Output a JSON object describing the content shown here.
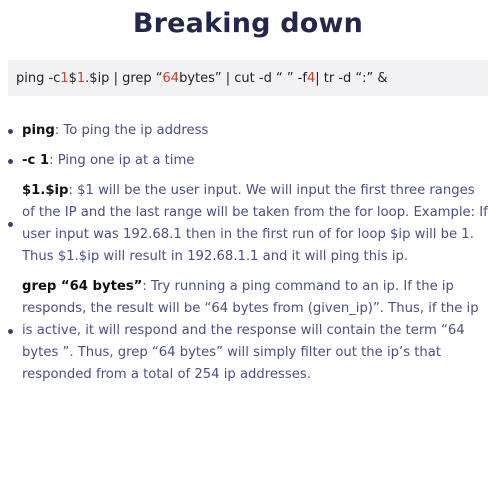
{
  "title": "Breaking down",
  "command": {
    "p1": "ping -c ",
    "n1": "1",
    "p2": " $",
    "n2": "1",
    "p3": ".$ip | grep “",
    "n3": "64",
    "p4": " bytes” | cut -d “ ” -f ",
    "n4": "4",
    "p5": " | tr -d “:” &"
  },
  "bullets": [
    {
      "term": "ping",
      "text": ": To ping the ip address"
    },
    {
      "term": "-c 1",
      "text": ": Ping one ip at a time"
    },
    {
      "term": "$1.$ip",
      "text": ": $1 will be the user input. We will input the first three ranges of the IP and the last range will be taken from the for loop. Example: If user input was 192.68.1 then in the first run of for loop $ip will be 1. Thus $1.$ip will result in 192.68.1.1 and it will ping this ip."
    },
    {
      "term": "grep “64 bytes”",
      "text": ": Try running a ping command to an ip. If the ip responds, the result will be “64 bytes from (given_ip)”. Thus, if the ip is active, it will respond and the response will contain the term “64 bytes ”. Thus, grep “64 bytes” will simply filter out the ip’s that responded from a total of 254 ip addresses."
    }
  ]
}
